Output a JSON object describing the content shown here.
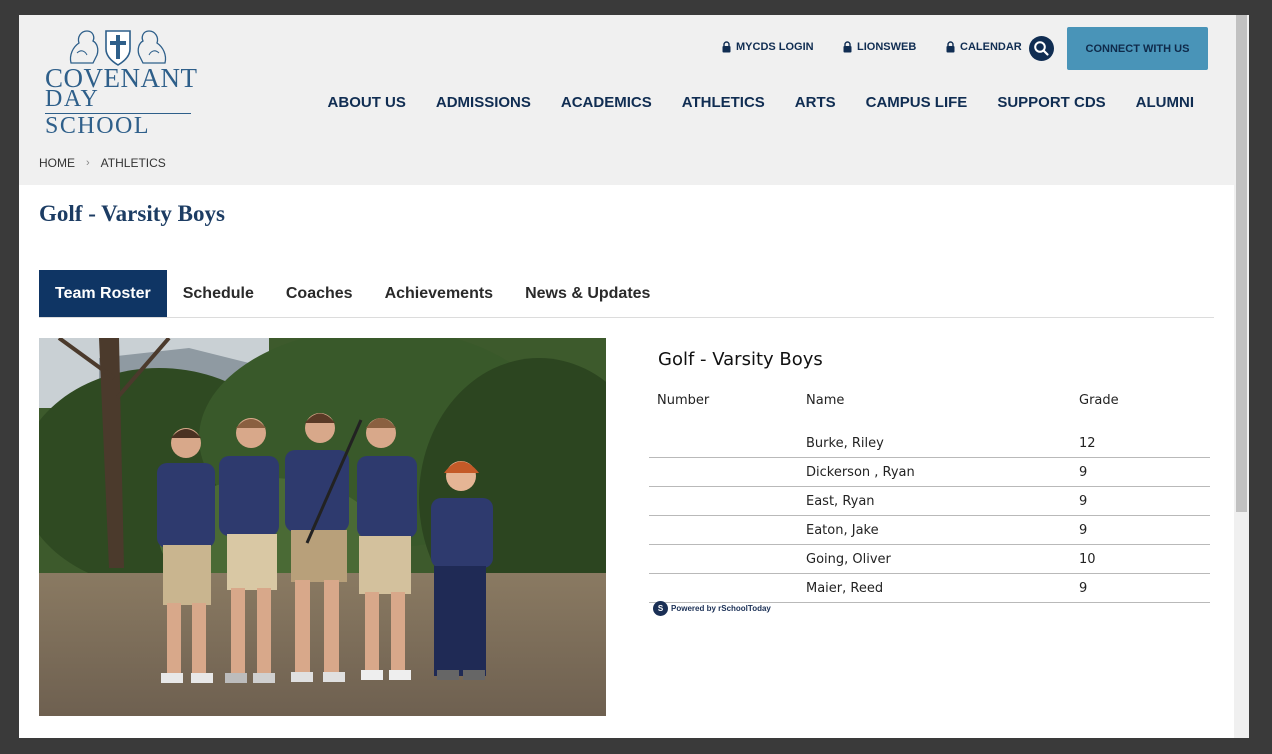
{
  "school": {
    "logo_line1": "COVENANT",
    "logo_line2": "DAY SCHOOL",
    "brand_color": "#102d52",
    "accent_color": "#4994b8"
  },
  "utility_nav": {
    "items": [
      {
        "label": "MYCDS LOGIN",
        "icon": "lock-icon"
      },
      {
        "label": "LIONSWEB",
        "icon": "lock-icon"
      },
      {
        "label": "CALENDAR",
        "icon": "lock-icon"
      }
    ],
    "search_icon": "search-icon",
    "connect_label": "CONNECT WITH US"
  },
  "main_nav": {
    "items": [
      "ABOUT US",
      "ADMISSIONS",
      "ACADEMICS",
      "ATHLETICS",
      "ARTS",
      "CAMPUS LIFE",
      "SUPPORT CDS",
      "ALUMNI"
    ]
  },
  "breadcrumb": {
    "items": [
      "HOME",
      "ATHLETICS"
    ]
  },
  "page": {
    "title": "Golf - Varsity Boys"
  },
  "tabs": {
    "items": [
      "Team Roster",
      "Schedule",
      "Coaches",
      "Achievements",
      "News & Updates"
    ],
    "active": "Team Roster"
  },
  "roster": {
    "title": "Golf - Varsity Boys",
    "columns": {
      "number": "Number",
      "name": "Name",
      "grade": "Grade"
    },
    "rows": [
      {
        "number": "",
        "name": "Burke, Riley",
        "grade": "12"
      },
      {
        "number": "",
        "name": "Dickerson , Ryan",
        "grade": "9"
      },
      {
        "number": "",
        "name": "East, Ryan",
        "grade": "9"
      },
      {
        "number": "",
        "name": "Eaton, Jake",
        "grade": "9"
      },
      {
        "number": "",
        "name": "Going, Oliver",
        "grade": "10"
      },
      {
        "number": "",
        "name": "Maier, Reed",
        "grade": "9"
      }
    ],
    "powered_by": "Powered by rSchoolToday"
  }
}
